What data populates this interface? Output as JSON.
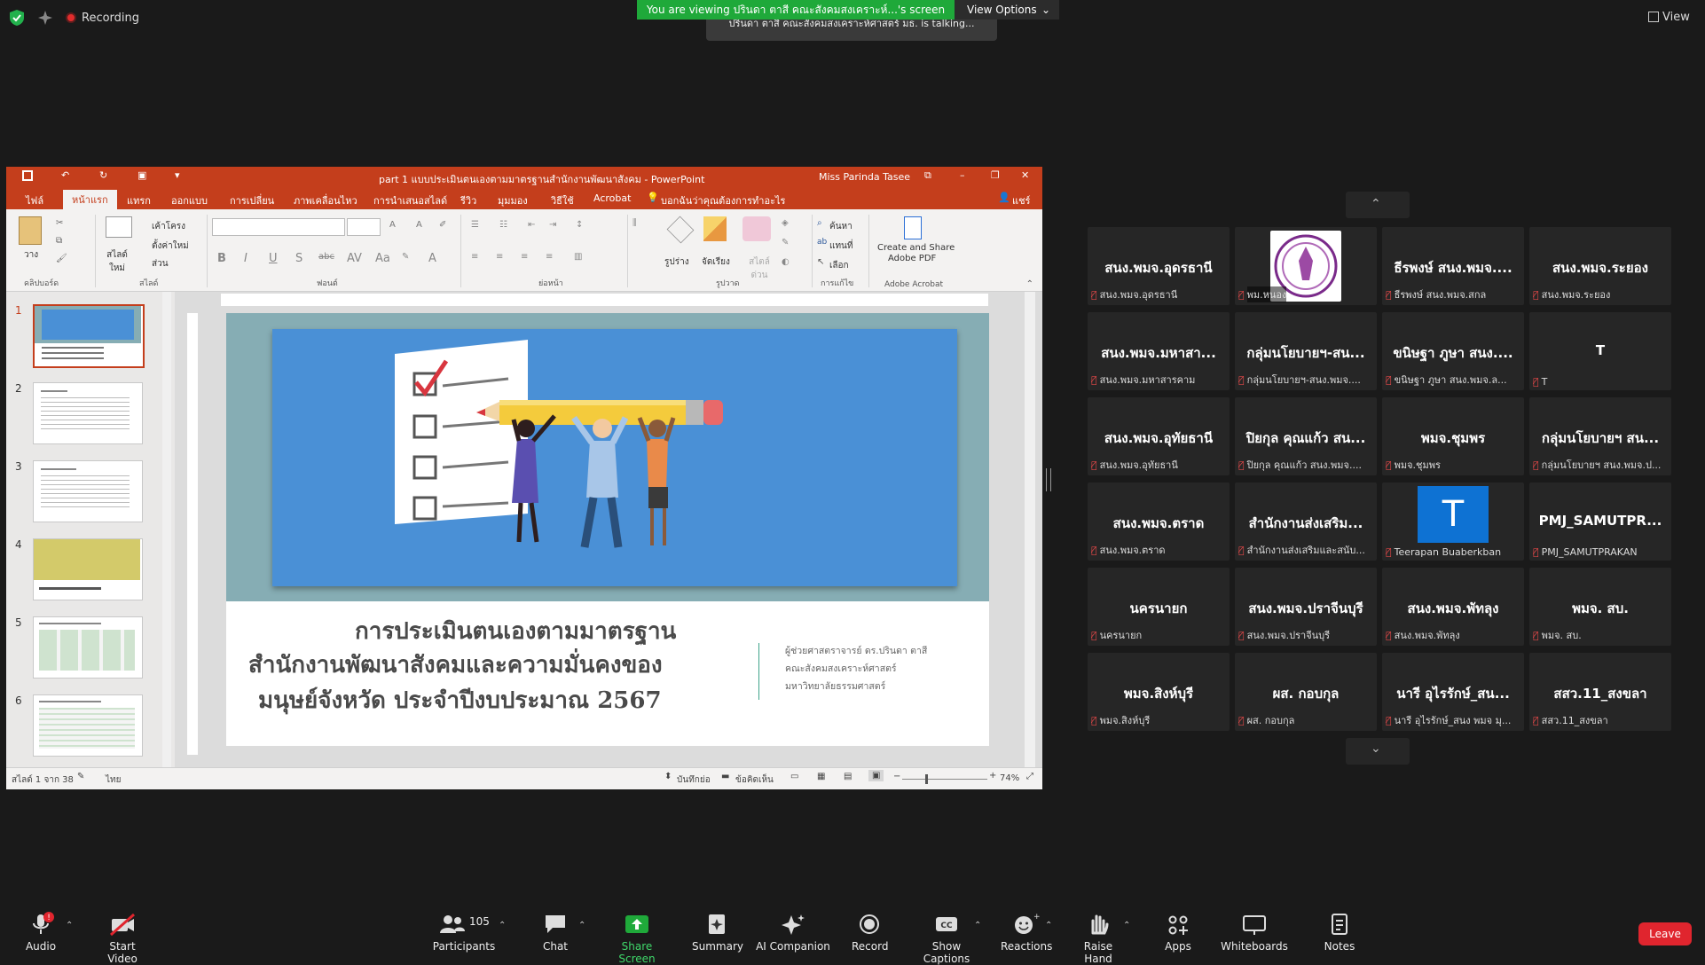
{
  "topbar": {
    "recording": "Recording",
    "viewing_banner": "You are viewing ปรินดา ตาสี คณะสังคมสงเคราะห์...'s screen",
    "view_options": "View Options",
    "talking": "ปรินดา ตาสี คณะสังคมสงเคราะห์ศาสตร์ มธ. is talking...",
    "view": "View"
  },
  "ppt": {
    "window_title": "part 1 แบบประเมินตนเองตามมาตรฐานสำนักงานพัฒนาสังคม - PowerPoint",
    "user": "Miss Parinda Tasee",
    "tabs": [
      "ไฟล์",
      "หน้าแรก",
      "แทรก",
      "ออกแบบ",
      "การเปลี่ยน",
      "ภาพเคลื่อนไหว",
      "การนำเสนอสไลด์",
      "รีวิว",
      "มุมมอง",
      "วิธีใช้",
      "Acrobat"
    ],
    "tell_me": "บอกฉันว่าคุณต้องการทำอะไร",
    "share": "แชร์",
    "ribbon": {
      "paste": "วาง",
      "clipboard": "คลิปบอร์ด",
      "new_slide": "สไลด์ใหม่",
      "layout": "เค้าโครง",
      "reset": "ตั้งค่าใหม่",
      "section": "ส่วน",
      "slides": "สไลด์",
      "font": "ฟอนต์",
      "paragraph": "ย่อหน้า",
      "shapes": "รูปร่าง",
      "arrange": "จัดเรียง",
      "quick_styles": "สไตล์ด่วน",
      "drawing": "รูปวาด",
      "find": "ค้นหา",
      "replace": "แทนที่",
      "select": "เลือก",
      "editing": "การแก้ไข",
      "create_share": "Create and Share",
      "adobe_pdf": "Adobe PDF",
      "adobe_acrobat": "Adobe Acrobat"
    },
    "thumb_numbers": [
      "1",
      "2",
      "3",
      "4",
      "5",
      "6"
    ],
    "slide": {
      "title1": "การประเมินตนเองตามมาตรฐาน",
      "title2": "สำนักงานพัฒนาสังคมและความมั่นคงของ",
      "title3": "มนุษย์จังหวัด ประจำปีงบประมาณ 2567",
      "presenter1": "ผู้ช่วยศาสตราจารย์ ดร.ปรินดา ตาสี",
      "presenter2": "คณะสังคมสงเคราะห์ศาสตร์",
      "presenter3": "มหาวิทยาลัยธรรมศาสตร์"
    },
    "status": {
      "slide_count": "สไลด์ 1 จาก 38",
      "language": "ไทย",
      "notes": "บันทึกย่อ",
      "comments": "ข้อคิดเห็น",
      "zoom": "74%"
    }
  },
  "participants": [
    {
      "name": "สนง.พมจ.อุดรธานี",
      "sub": "สนง.พมจ.อุดรธานี",
      "type": "text"
    },
    {
      "name": "",
      "sub": "พม.หนอง",
      "type": "logo"
    },
    {
      "name": "ธีรพงษ์ สนง.พมจ....",
      "sub": "ธีรพงษ์ สนง.พมจ.สกล",
      "type": "text"
    },
    {
      "name": "สนง.พมจ.ระยอง",
      "sub": "สนง.พมจ.ระยอง",
      "type": "text"
    },
    {
      "name": "สนง.พมจ.มหาสา...",
      "sub": "สนง.พมจ.มหาสารคาม",
      "type": "text"
    },
    {
      "name": "กลุ่มนโยบายฯ-สน...",
      "sub": "กลุ่มนโยบายฯ-สนง.พมจ....",
      "type": "text"
    },
    {
      "name": "ขนิษฐา ภูษา สนง....",
      "sub": "ขนิษฐา ภูษา สนง.พมจ.ล...",
      "type": "text"
    },
    {
      "name": "T",
      "sub": "T",
      "type": "text"
    },
    {
      "name": "สนง.พมจ.อุทัยธานี",
      "sub": "สนง.พมจ.อุทัยธานี",
      "type": "text"
    },
    {
      "name": "ปิยกุล คุณแก้ว สน...",
      "sub": "ปิยกุล คุณแก้ว สนง.พมจ....",
      "type": "text"
    },
    {
      "name": "พมจ.ชุมพร",
      "sub": "พมจ.ชุมพร",
      "type": "text"
    },
    {
      "name": "กลุ่มนโยบายฯ สน...",
      "sub": "กลุ่มนโยบายฯ สนง.พมจ.ป...",
      "type": "text"
    },
    {
      "name": "สนง.พมจ.ตราด",
      "sub": "สนง.พมจ.ตราด",
      "type": "text"
    },
    {
      "name": "สำนักงานส่งเสริม...",
      "sub": "สำนักงานส่งเสริมและสนับ...",
      "type": "text"
    },
    {
      "name": "T",
      "sub": "Teerapan Buaberkban",
      "type": "avatar"
    },
    {
      "name": "PMJ_SAMUTPR...",
      "sub": "PMJ_SAMUTPRAKAN",
      "type": "text"
    },
    {
      "name": "นครนายก",
      "sub": "นครนายก",
      "type": "text"
    },
    {
      "name": "สนง.พมจ.ปราจีนบุรี",
      "sub": "สนง.พมจ.ปราจีนบุรี",
      "type": "text"
    },
    {
      "name": "สนง.พมจ.พัทลุง",
      "sub": "สนง.พมจ.พัทลุง",
      "type": "text"
    },
    {
      "name": "พมจ. สบ.",
      "sub": "พมจ. สบ.",
      "type": "text"
    },
    {
      "name": "พมจ.สิงห์บุรี",
      "sub": "พมจ.สิงห์บุรี",
      "type": "text"
    },
    {
      "name": "ผส. กอบกุล",
      "sub": "ผส. กอบกุล",
      "type": "text"
    },
    {
      "name": "นารี อุไรรักษ์_สน...",
      "sub": "นารี อุไรรักษ์_สนง พมจ มุ...",
      "type": "text"
    },
    {
      "name": "สสว.11_สงขลา",
      "sub": "สสว.11_สงขลา",
      "type": "text"
    }
  ],
  "toolbar": {
    "audio": "Audio",
    "start_video": "Start Video",
    "participants": "Participants",
    "participant_count": "105",
    "chat": "Chat",
    "share_screen": "Share Screen",
    "summary": "Summary",
    "ai_companion": "AI Companion",
    "record": "Record",
    "show_captions": "Show Captions",
    "reactions": "Reactions",
    "raise_hand": "Raise Hand",
    "apps": "Apps",
    "whiteboards": "Whiteboards",
    "notes": "Notes",
    "leave": "Leave",
    "audio_badge": "!"
  },
  "colors": {
    "ppt_accent": "#c43e1c",
    "share_green": "#1fa93a",
    "leave_red": "#e0252e",
    "slide_blue": "#4a90d6",
    "avatar_blue": "#0e72d3"
  }
}
